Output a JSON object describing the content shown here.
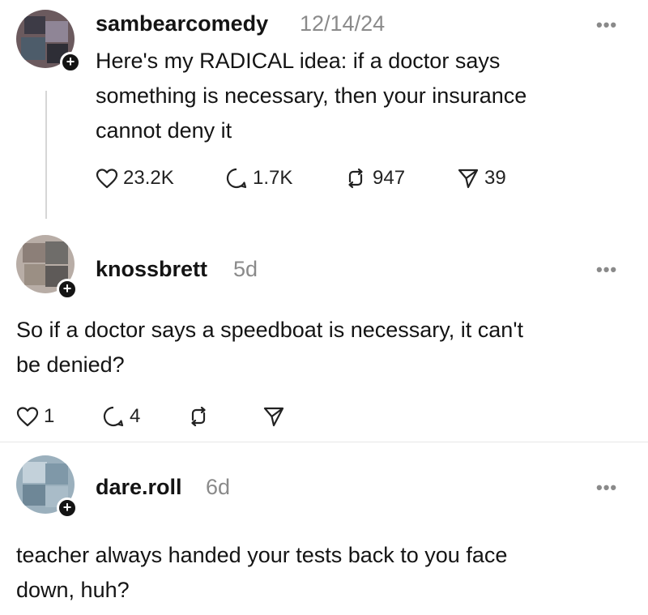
{
  "posts": [
    {
      "username": "sambearcomedy",
      "timestamp": "12/14/24",
      "more_label": "•••",
      "follow_label": "+",
      "text_lines": [
        "Here's my RADICAL idea: if a doctor says",
        "something is necessary, then your  insurance",
        "cannot deny it"
      ],
      "likes": "23.2K",
      "replies": "1.7K",
      "reposts": "947",
      "shares": "39"
    },
    {
      "username": "knossbrett",
      "timestamp": "5d",
      "more_label": "•••",
      "follow_label": "+",
      "text_lines": [
        "So if a doctor says a speedboat is necessary, it can't",
        "be denied?"
      ],
      "likes": "1",
      "replies": "4",
      "reposts": "",
      "shares": ""
    },
    {
      "username": "dare.roll",
      "timestamp": "6d",
      "more_label": "•••",
      "follow_label": "+",
      "text_lines": [
        "teacher always handed your tests back to you face",
        "down, huh?"
      ]
    }
  ],
  "icons": {
    "like": "heart-icon",
    "reply": "comment-icon",
    "repost": "repost-icon",
    "share": "send-icon",
    "more": "more-options-icon"
  },
  "colors": {
    "text": "#141414",
    "muted": "#8a8a8a",
    "background": "#ffffff"
  }
}
